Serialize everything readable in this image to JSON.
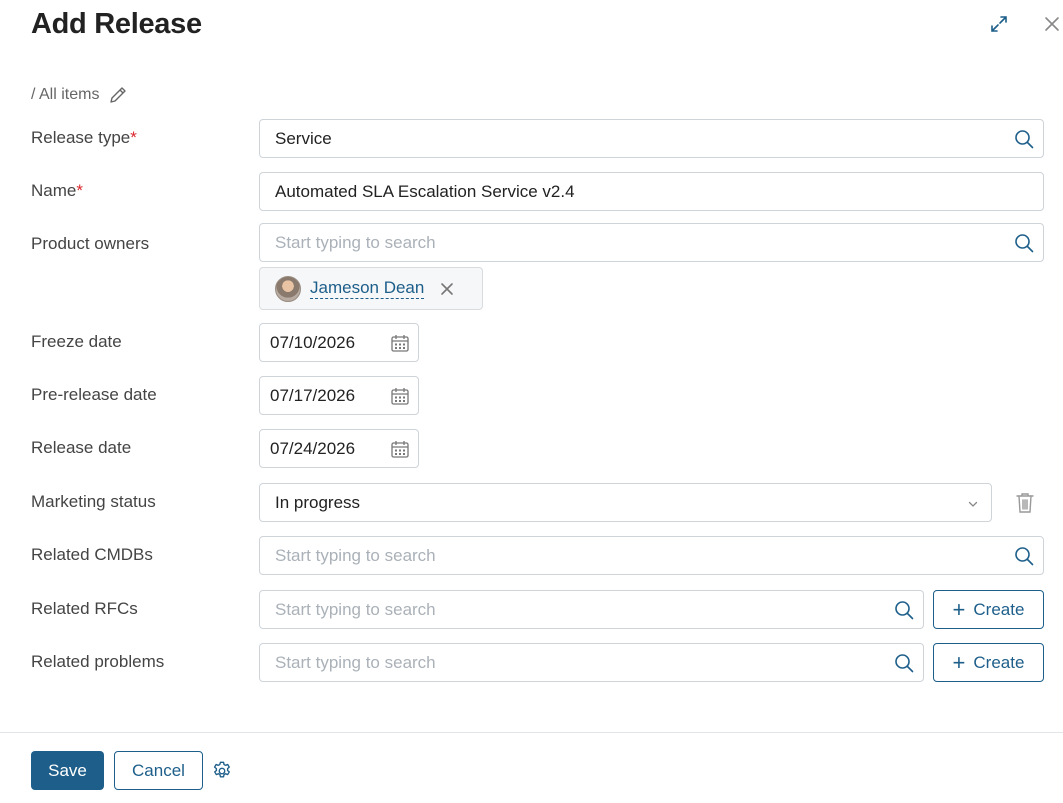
{
  "header": {
    "title": "Add Release",
    "expand_icon": "expand-icon",
    "close_icon": "close-icon"
  },
  "breadcrumb": {
    "text": "/ All items",
    "edit_icon": "pencil-icon"
  },
  "form": {
    "release_type": {
      "label": "Release type",
      "required_mark": "*",
      "value": "Service"
    },
    "name": {
      "label": "Name",
      "required_mark": "*",
      "value": "Automated SLA Escalation Service v2.4"
    },
    "product_owners": {
      "label": "Product owners",
      "placeholder": "Start typing to search",
      "selected": [
        {
          "name": "Jameson Dean"
        }
      ]
    },
    "freeze_date": {
      "label": "Freeze date",
      "value": "07/10/2026"
    },
    "pre_release_date": {
      "label": "Pre-release date",
      "value": "07/17/2026"
    },
    "release_date": {
      "label": "Release date",
      "value": "07/24/2026"
    },
    "marketing_status": {
      "label": "Marketing status",
      "value": "In progress"
    },
    "related_cmdbs": {
      "label": "Related CMDBs",
      "placeholder": "Start typing to search"
    },
    "related_rfcs": {
      "label": "Related RFCs",
      "placeholder": "Start typing to search",
      "create_label": "Create"
    },
    "related_problems": {
      "label": "Related problems",
      "placeholder": "Start typing to search",
      "create_label": "Create"
    }
  },
  "footer": {
    "save_label": "Save",
    "cancel_label": "Cancel",
    "settings_icon": "gear-icon"
  },
  "colors": {
    "accent": "#1d5f8a",
    "required": "#d9262c",
    "border": "#cfd4d9",
    "placeholder": "#aab1b8"
  }
}
